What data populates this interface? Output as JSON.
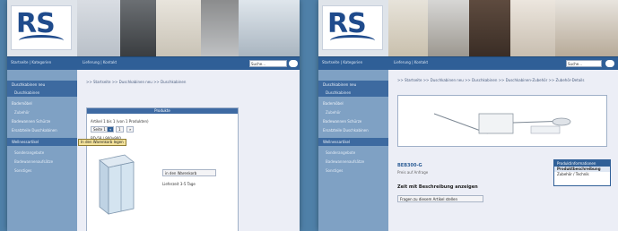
{
  "left_window": {
    "logo_text": "RS",
    "nav": {
      "link1": "Startseite | Kategorien",
      "link2": "Lieferung | Kontakt",
      "search_value": "Suche...",
      "search_icon": "search-icon"
    },
    "breadcrumb": ">> Startseite >> Duschkabinen neu >> Duschkabinen",
    "sidebar": [
      "Duschkabinen neu",
      "Duschkabinen",
      "Bademöbel",
      "Zubehör",
      "Badewannen Schürze",
      "Ersatzteile Duschkabinen",
      "Wellnessartikel",
      "Sonderangebote",
      "Badewannenaufsätze",
      "Sonstiges"
    ],
    "box": {
      "title": "Produkte",
      "count_line": "Artikel 1 bis 1 (von 1 Produkten)",
      "pagination": [
        "Seite 1",
        "«",
        "1",
        "»"
      ],
      "product_name": "BD-58 / 900x900",
      "product_sub": "Preis auf Anfrage",
      "cart_button": "in den Warenkorb",
      "price_label": "Lieferzeit 3-5 Tage"
    },
    "tooltip": "In den Warenkorb legen"
  },
  "right_window": {
    "logo_text": "RS",
    "nav": {
      "link1": "Startseite | Kategorien",
      "link2": "Lieferung | Kontakt",
      "search_value": "Suche...",
      "search_icon": "search-icon"
    },
    "breadcrumb": ">> Startseite >> Duschkabinen neu >> Duschkabinen >> Duschkabinen-Zubehör >> Zubehör-Details",
    "sidebar": [
      "Duschkabinen neu",
      "Duschkabinen",
      "Bademöbel",
      "Zubehör",
      "Badewannen Schürze",
      "Ersatzteile Duschkabinen",
      "Wellnessartikel",
      "Sonderangebote",
      "Badewannenaufsätze",
      "Sonstiges"
    ],
    "product_title": "BEB300-G",
    "product_sub": "Preis auf Anfrage",
    "question_title": "Zeit mit Beschreibung anzeigen",
    "action_button": "Fragen zu diesem Artikel stellen",
    "popup": {
      "title": "Produktinformationen",
      "rows": [
        "Produktbeschreibung",
        "Zubehör / Technik"
      ]
    }
  }
}
